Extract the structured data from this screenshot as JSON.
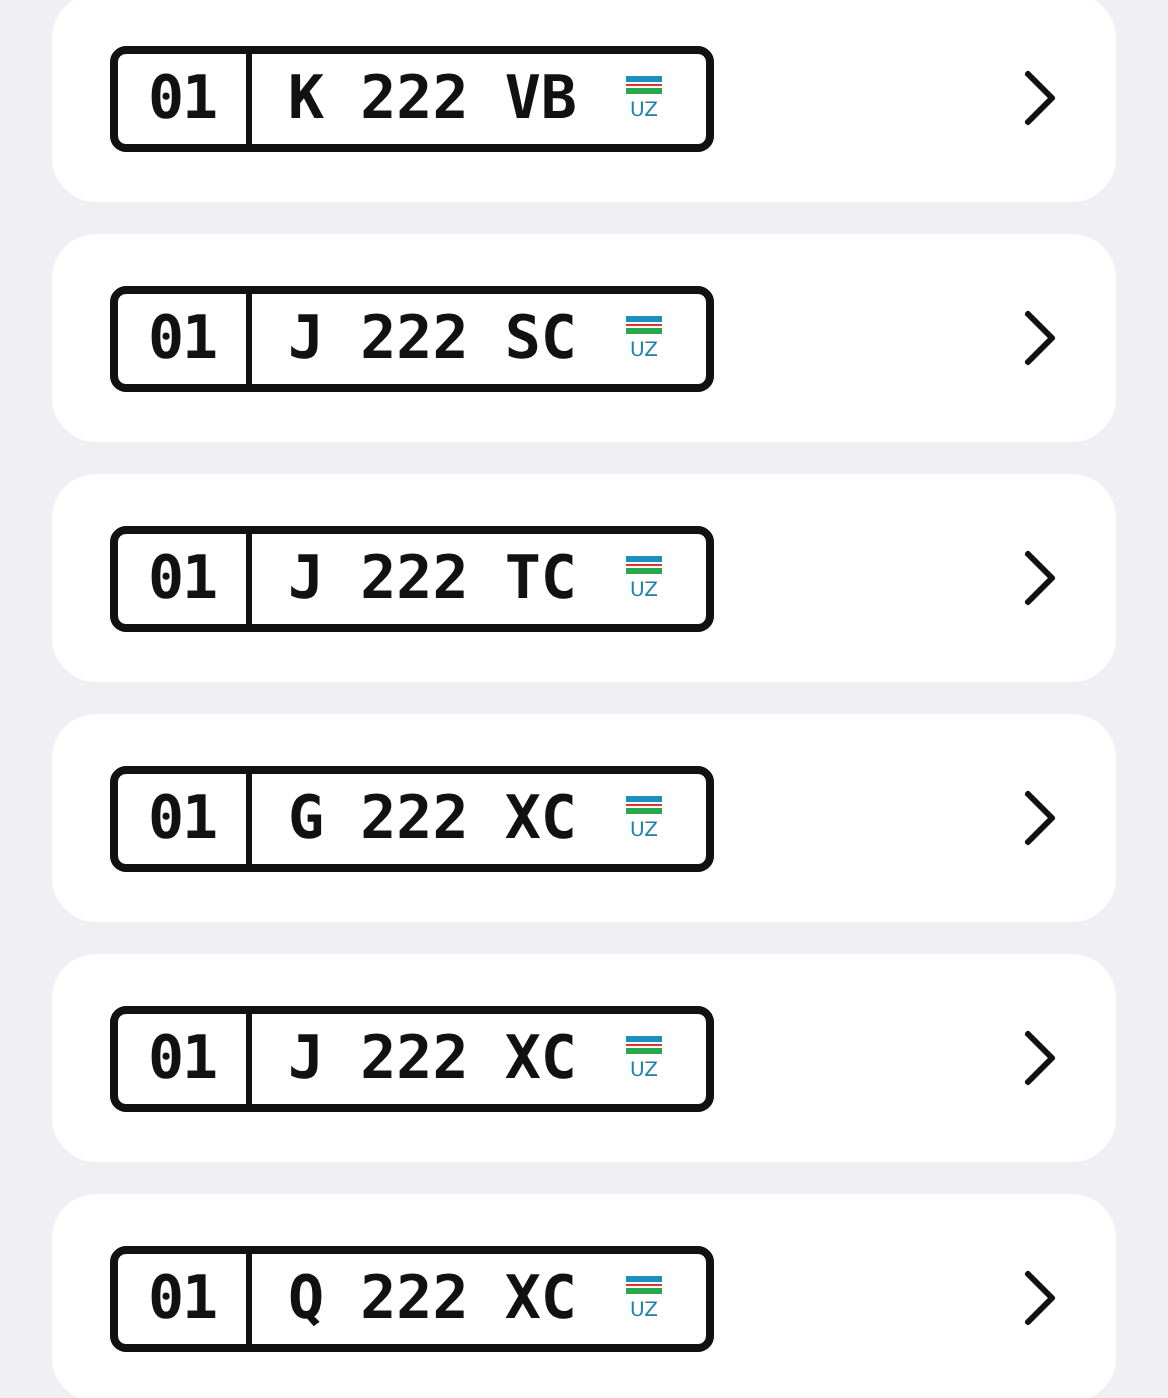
{
  "plates": [
    {
      "region": "01",
      "number": "K 222 VB",
      "country": "UZ"
    },
    {
      "region": "01",
      "number": "J 222 SC",
      "country": "UZ"
    },
    {
      "region": "01",
      "number": "J 222 TC",
      "country": "UZ"
    },
    {
      "region": "01",
      "number": "G 222 XC",
      "country": "UZ"
    },
    {
      "region": "01",
      "number": "J 222 XC",
      "country": "UZ"
    },
    {
      "region": "01",
      "number": "Q 222 XC",
      "country": "UZ"
    }
  ]
}
